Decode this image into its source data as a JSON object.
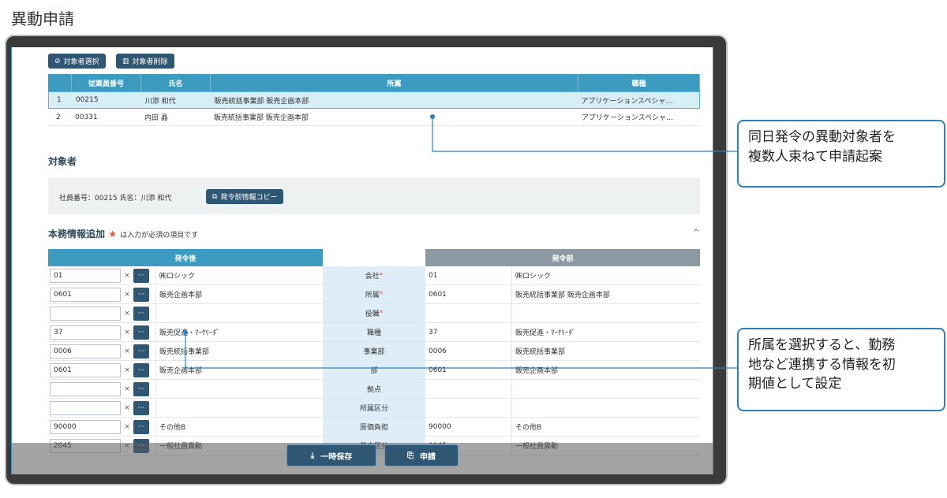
{
  "page_title": "異動申請",
  "top_buttons": {
    "select_label": "対象者選択",
    "delete_label": "対象者削除"
  },
  "top_table": {
    "headers": [
      "",
      "従業員番号",
      "氏名",
      "所属",
      "職種"
    ],
    "rows": [
      [
        "1",
        "00215",
        "川添 和代",
        "販売統括事業部 販売企画本部",
        "アプリケーションスペシャ…"
      ],
      [
        "2",
        "00331",
        "内田 晶",
        "販売統括事業部 販売企画本部",
        "アプリケーションスペシャ…"
      ]
    ]
  },
  "target": {
    "title": "対象者",
    "info": "社員番号：00215 氏名：川添 和代",
    "copy_button": "発令前情報コピー"
  },
  "duties": {
    "title": "本務情報追加",
    "star": "★",
    "required_note": "は入力が必須の項目です",
    "after_header": "発令後",
    "before_header": "発令前",
    "clear_glyph": "×",
    "dots_glyph": "···",
    "rows": [
      {
        "code": "01",
        "name": "㈱ロシック",
        "label": "会社",
        "req": "*",
        "bcode": "01",
        "bname": "㈱ロシック"
      },
      {
        "code": "0601",
        "name": "販売企画本部",
        "label": "所属",
        "req": "*",
        "bcode": "0601",
        "bname": "販売統括事業部 販売企画本部"
      },
      {
        "code": "",
        "name": "",
        "label": "役職",
        "req": "*",
        "bcode": "",
        "bname": ""
      },
      {
        "code": "37",
        "name": "販売促進・ﾏｰｹﾘｰﾀﾞ",
        "label": "職種",
        "req": "",
        "bcode": "37",
        "bname": "販売促進・ﾏｰｹﾘｰﾀﾞ"
      },
      {
        "code": "0006",
        "name": "販売統括事業部",
        "label": "事業部",
        "req": "",
        "bcode": "0006",
        "bname": "販売統括事業部"
      },
      {
        "code": "0601",
        "name": "販売企画本部",
        "label": "部",
        "req": "",
        "bcode": "0601",
        "bname": "販売企画本部"
      },
      {
        "code": "",
        "name": "",
        "label": "拠点",
        "req": "",
        "bcode": "",
        "bname": ""
      },
      {
        "code": "",
        "name": "",
        "label": "所属区分",
        "req": "",
        "bcode": "",
        "bname": ""
      },
      {
        "code": "90000",
        "name": "その他B",
        "label": "原価負担",
        "req": "",
        "bcode": "90000",
        "bname": "その他B"
      },
      {
        "code": "2045",
        "name": "一般社員異動",
        "label": "発令区分",
        "req": "",
        "bcode": "2045",
        "bname": "一般社員異動"
      }
    ]
  },
  "footer": {
    "save_label": "一時保存",
    "apply_label": "申請"
  },
  "callouts": {
    "first": [
      "同日発令の異動対象者を",
      "複数人束ねて申請起案"
    ],
    "second": [
      "所属を選択すると、勤務",
      "地など連携する情報を初",
      "期値として設定"
    ]
  },
  "colors": {
    "accent": "#3d9ac0",
    "dark_button": "#2f5673",
    "callout_border": "#2d80bd"
  }
}
